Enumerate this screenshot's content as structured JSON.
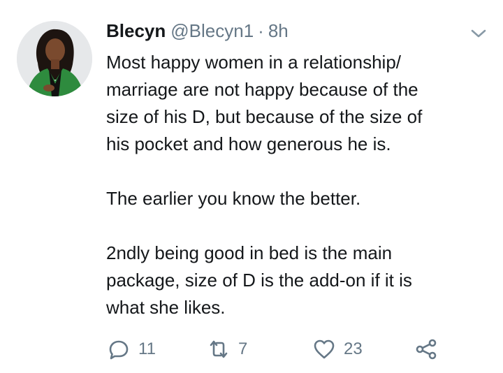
{
  "tweet": {
    "author_name": "Blecyn",
    "author_handle": "@Blecyn1",
    "separator": "·",
    "time": "8h",
    "paragraphs": [
      "Most happy women in a relationship/\nmarriage are not happy because of the\nsize of his D, but because of the size of\nhis pocket and how generous he is.",
      "The earlier you know the better.",
      "2ndly being good in bed is the main\npackage, size of D is the add-on if it is\nwhat she likes."
    ],
    "actions": {
      "reply_count": "11",
      "retweet_count": "7",
      "like_count": "23"
    }
  },
  "colors": {
    "text": "#14171a",
    "secondary": "#657786",
    "avatar_jacket": "#2e8b3e"
  },
  "icons": [
    "chevron-down-icon",
    "reply-icon",
    "retweet-icon",
    "like-icon",
    "share-icon"
  ]
}
